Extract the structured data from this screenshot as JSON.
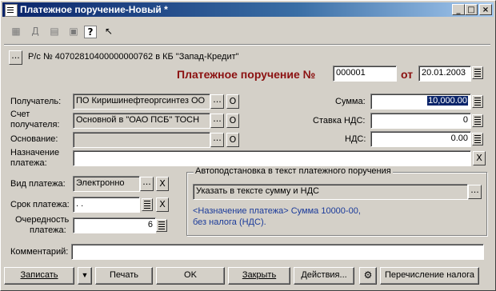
{
  "window": {
    "title": "Платежное поручение-Новый *",
    "min": "_",
    "max": "□",
    "close": "×"
  },
  "toolbar": {
    "icons": [
      "doc-icon",
      "dt-kt-icon",
      "edit-icon",
      "post-icon",
      "help-icon",
      "pointer-help-icon"
    ],
    "help_glyph": "?"
  },
  "account": {
    "button": "...",
    "text": "Р/с № 40702810400000000762 в КБ \"Запад-Кредит\""
  },
  "header": {
    "title": "Платежное поручение №",
    "number": "000001",
    "from_label": "от",
    "date": "20.01.2003"
  },
  "labels": {
    "recipient": "Получатель:",
    "recipient_account_1": "Счет",
    "recipient_account_2": "получателя:",
    "basis": "Основание:",
    "purpose_1": "Назначение",
    "purpose_2": "платежа:",
    "sum": "Сумма:",
    "vat_rate": "Ставка НДС:",
    "vat": "НДС:",
    "payment_type": "Вид платежа:",
    "payment_term": "Срок платежа:",
    "priority_1": "Очередность",
    "priority_2": "платежа:",
    "comment": "Комментарий:"
  },
  "fields": {
    "recipient": "ПО Киришинефтеоргсинтез ОО",
    "recipient_account": "Основной в \"ОАО ПСБ\" ТОСН",
    "basis": "",
    "purpose": "",
    "sum": "10,000.00",
    "vat_rate": "0",
    "vat": "0.00",
    "payment_type": "Электронно",
    "payment_term": " .  .",
    "priority": "6",
    "comment": ""
  },
  "small_buttons": {
    "dots": "...",
    "o": "О",
    "x": "X"
  },
  "autofill": {
    "title": "Автоподстановка в текст платежного поручения",
    "select": "Указать в тексте сумму и НДС",
    "note_line1": "<Назначение платежа> Сумма 10000-00,",
    "note_line2": "без налога (НДС)."
  },
  "buttons": {
    "save": "Записать",
    "save_menu": "▼",
    "print": "Печать",
    "ok": "OK",
    "close": "Закрыть",
    "actions": "Действия...",
    "transfer_tax": "Перечисление налога"
  }
}
